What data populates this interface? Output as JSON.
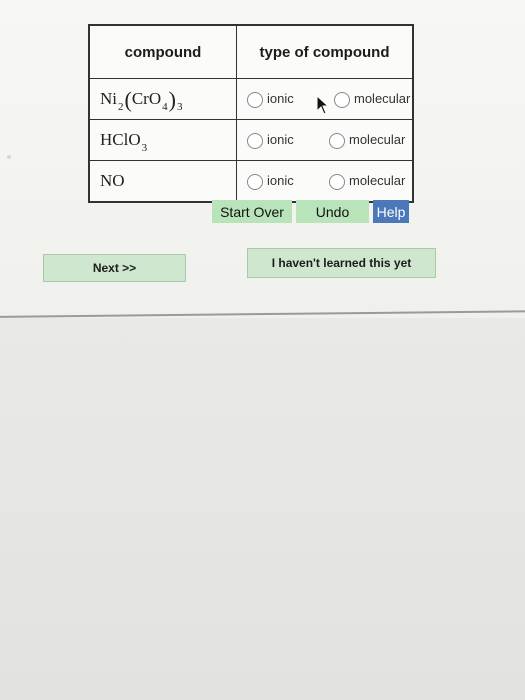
{
  "table": {
    "headers": {
      "compound": "compound",
      "type": "type of compound"
    },
    "rows": [
      {
        "parts": [
          "Ni",
          "2",
          "(",
          "CrO",
          "4",
          ")",
          "3"
        ],
        "ionic_label": "ionic",
        "molecular_label": "molecular"
      },
      {
        "parts": [
          "HClO",
          "3"
        ],
        "ionic_label": "ionic",
        "molecular_label": "molecular"
      },
      {
        "parts": [
          "NO"
        ],
        "ionic_label": "ionic",
        "molecular_label": "molecular"
      }
    ]
  },
  "toolbar": {
    "start_over": "Start Over",
    "undo": "Undo",
    "help": "Help"
  },
  "footer": {
    "next": "Next >>",
    "havent_learned": "I haven't learned this yet"
  },
  "colors": {
    "action_green": "#b9e4b9",
    "help_blue": "#4a78b9"
  }
}
